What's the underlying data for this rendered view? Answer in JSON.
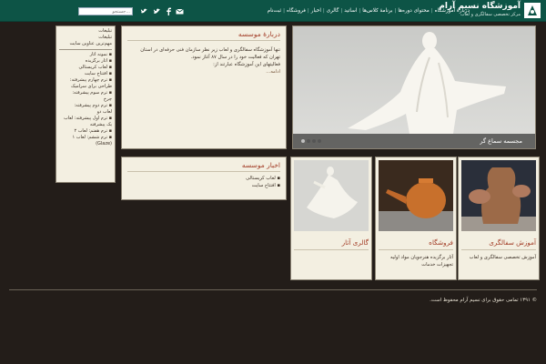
{
  "header": {
    "brand": "آموزشگاه نسیم آرام",
    "slogan": "مرکز تخصصی سفالگری و لعاب",
    "search_placeholder": "جستجو...",
    "nav": [
      "دربارهٔ آموزشگاه",
      "محتوای دوره‌ها",
      "برنامهٔ کلاس‌ها",
      "اساتید",
      "گالری",
      "اخبار",
      "فروشگاه",
      "ثبت‌نام"
    ],
    "colors": {
      "bar": "#0d5446",
      "accent": "#a23c26",
      "panel": "#f3efe1",
      "page": "#231d19"
    }
  },
  "sidebar": {
    "lines": [
      {
        "t": "تبلیغات",
        "k": "hd"
      },
      {
        "t": "تبلیغات",
        "k": "hd"
      },
      {
        "t": "مهم‌ترین عناوین سایت",
        "k": "hd"
      },
      {
        "t": "",
        "k": "rule"
      },
      {
        "t": "نمونه آثار",
        "k": "bul"
      },
      {
        "t": "آثار برگزیده",
        "k": "bul"
      },
      {
        "t": "لعاب کریستالی",
        "k": "bul"
      },
      {
        "t": "افتتاح سایت",
        "k": "bul"
      },
      {
        "t": "ترم چهارم پیشرفته:",
        "k": "bul"
      },
      {
        "t": "طراحی برای سرامیک",
        "k": ""
      },
      {
        "t": "ترم سوم پیشرفته:",
        "k": "bul"
      },
      {
        "t": "چرخ",
        "k": ""
      },
      {
        "t": "ترم دوم پیشرفته:",
        "k": "bul"
      },
      {
        "t": "لعاب دو",
        "k": ""
      },
      {
        "t": "ترم اول پیشرفته: لعاب",
        "k": "bul"
      },
      {
        "t": "یک پیشرفته",
        "k": ""
      },
      {
        "t": "ترم هفتم: لعاب ۲",
        "k": "bul"
      },
      {
        "t": "ترم ششم: لعاب ۱",
        "k": "bul"
      },
      {
        "t": "(Glaze)",
        "k": ""
      }
    ]
  },
  "about": {
    "title": "دربارهٔ موسسه",
    "lines": [
      "تنها آموزشگاه سفالگری و لعاب زیر نظر سازمان فنی حرفه‌ای در استان",
      "تهران که فعالیت خود را در سال ۸۷ آغاز نمود.",
      "فعالیتهای این آموزشگاه عبارتند از:",
      "ادامه..."
    ]
  },
  "news": {
    "title": "اخبار موسسه",
    "items": [
      "لعاب کریستالی",
      "افتتاح سایت"
    ]
  },
  "slider": {
    "caption": "مجسمه سماع گر",
    "dots": 4,
    "active_dot": 0
  },
  "cards": [
    {
      "title": "آموزش سفالگری",
      "desc": "آموزش تخصصی سفالگری و لعاب",
      "icon": "pottery-wheel-photo"
    },
    {
      "title": "فروشگاه",
      "desc": "آثار برگزیده هنرجویان مواد اولیه تجهیزات خدمات",
      "icon": "teapot-photo"
    },
    {
      "title": "گالری آثار",
      "desc": "",
      "icon": "whirling-dervish-sculpture-photo"
    }
  ],
  "footer": {
    "copyright": "© ۱۳۹۱ تمامی حقوق برای نسیم آرام محفوظ است."
  }
}
